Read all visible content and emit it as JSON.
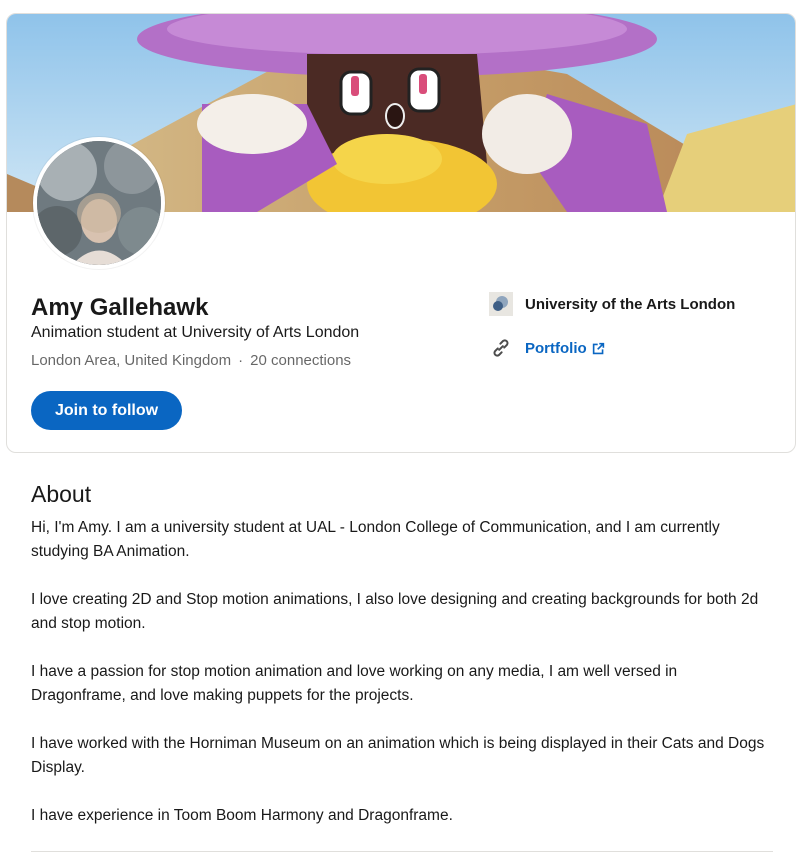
{
  "profile": {
    "name": "Amy Gallehawk",
    "headline": "Animation student at University of Arts London",
    "location": "London Area, United Kingdom",
    "separator": "·",
    "connections": "20 connections",
    "follow_button": "Join to follow",
    "education": "University of the Arts London",
    "portfolio_label": "Portfolio"
  },
  "about": {
    "title": "About",
    "paragraphs": [
      "Hi, I'm Amy. I am a university student at UAL - London College of Communication, and I am currently studying BA Animation.",
      "I love creating 2D and Stop motion animations, I also love designing and creating backgrounds for both 2d and stop motion.",
      "I have a passion for stop motion animation and love working on any media, I am well versed in Dragonframe, and love making puppets for the projects.",
      "I have worked with the Horniman Museum on an animation which is being displayed in their Cats and Dogs Display.",
      "I have experience in Toom Boom Harmony and Dragonframe."
    ]
  },
  "colors": {
    "brand_blue": "#0a66c2",
    "text_secondary": "rgba(0,0,0,0.6)"
  },
  "icons": [
    "university-logo-icon",
    "link-icon",
    "external-link-icon"
  ]
}
